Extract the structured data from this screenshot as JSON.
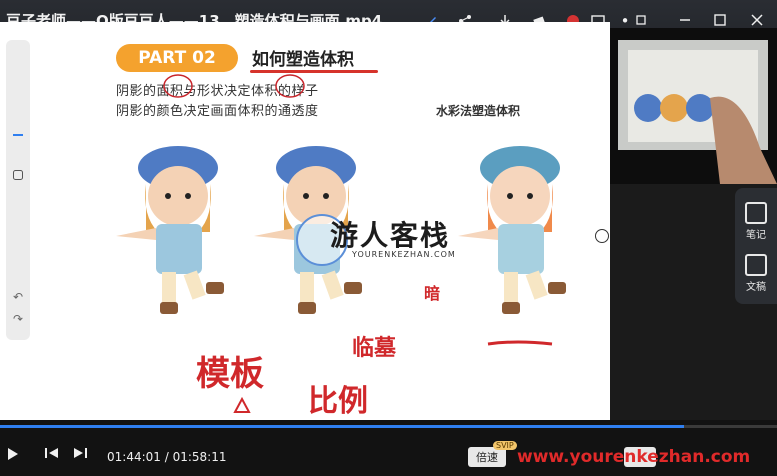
{
  "window": {
    "title": "豆子老师——Q版豆豆人——13、塑造体积与画面.mp4"
  },
  "slide": {
    "badge": "PART 02",
    "heading": "如何塑造体积",
    "line1": "阴影的面积与形状决定体积的样子",
    "line2": "阴影的颜色决定画面体积的通透度",
    "watercolor_label": "水彩法塑造体积",
    "handwriting": {
      "a": "模板",
      "b": "比例",
      "c": "临墓",
      "d": "暗"
    }
  },
  "watermark": {
    "text": "游人客栈",
    "sub": "YOURENKEZHAN.COM"
  },
  "dock": {
    "notes_label": "笔记",
    "draft_label": "文稿"
  },
  "player": {
    "time": "01:44:01 / 01:58:11",
    "progress": 0.88,
    "speed_label": "倍速",
    "svip": "SVIP",
    "site": "www.yourenkezhan.com"
  },
  "icons": {
    "share": "share-icon",
    "download": "download-icon",
    "pen": "pen-icon",
    "eraser": "eraser-icon",
    "record": "record-icon",
    "minimize": "minimize-icon",
    "maximize": "maximize-icon",
    "close": "close-icon"
  },
  "colors": {
    "accent": "#f4a22e",
    "red": "#d6332b",
    "progress": "#2f7ff0"
  }
}
